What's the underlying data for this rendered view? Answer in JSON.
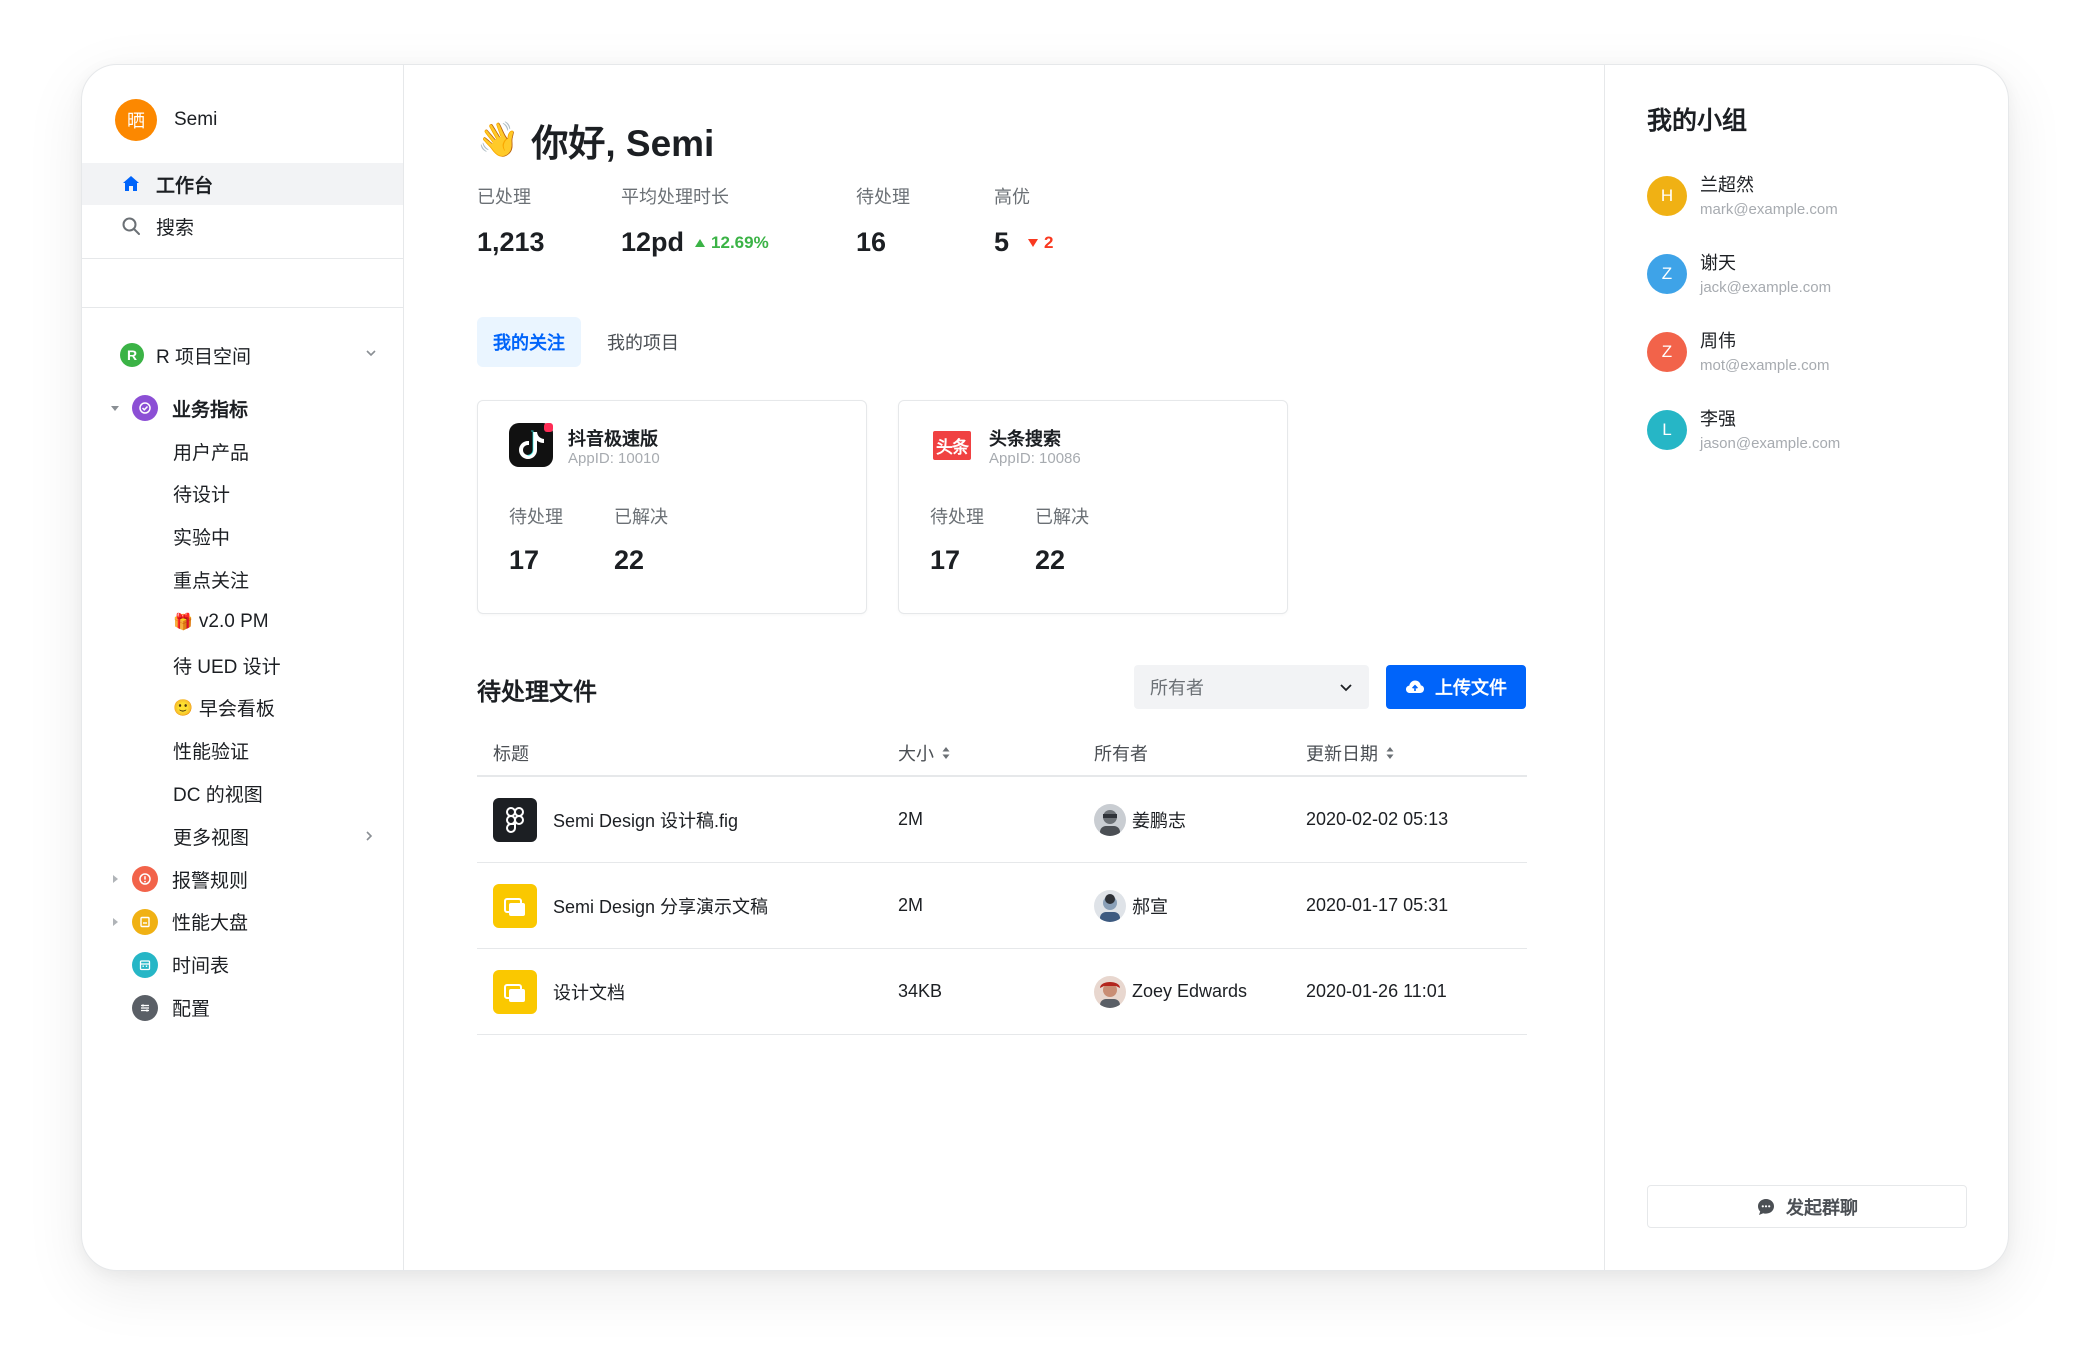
{
  "brand": {
    "logo_text": "晒",
    "name": "Semi"
  },
  "nav": [
    {
      "label": "工作台",
      "icon": "home-icon"
    },
    {
      "label": "搜索",
      "icon": "search-icon"
    }
  ],
  "space": {
    "badge": "R",
    "label": "R 项目空间"
  },
  "tree": {
    "group": "业务指标",
    "children": [
      "用户产品",
      "待设计",
      "实验中",
      "重点关注",
      "v2.0 PM",
      "待 UED 设计",
      "早会看板",
      "性能验证",
      "DC 的视图",
      "更多视图"
    ],
    "others": [
      "报警规则",
      "性能大盘",
      "时间表",
      "配置"
    ]
  },
  "greeting": {
    "emoji": "👋",
    "text": "你好, Semi"
  },
  "stats": [
    {
      "label": "已处理",
      "value": "1,213"
    },
    {
      "label": "平均处理时长",
      "value": "12pd",
      "trend": "12.69%"
    },
    {
      "label": "待处理",
      "value": "16"
    },
    {
      "label": "高优",
      "value": "5",
      "trend": "2"
    }
  ],
  "tabs": [
    "我的关注",
    "我的项目"
  ],
  "apps": [
    {
      "name": "抖音极速版",
      "appid": "AppID: 10010",
      "pending_label": "待处理",
      "pending": "17",
      "resolved_label": "已解决",
      "resolved": "22"
    },
    {
      "name": "头条搜索",
      "appid": "AppID: 10086",
      "logo_text": "头条",
      "pending_label": "待处理",
      "pending": "17",
      "resolved_label": "已解决",
      "resolved": "22"
    }
  ],
  "files": {
    "title": "待处理文件",
    "owner_select": "所有者",
    "upload_label": "上传文件",
    "columns": [
      "标题",
      "大小",
      "所有者",
      "更新日期"
    ],
    "rows": [
      {
        "title": "Semi Design 设计稿.fig",
        "size": "2M",
        "owner": "姜鹏志",
        "date": "2020-02-02 05:13"
      },
      {
        "title": "Semi Design 分享演示文稿",
        "size": "2M",
        "owner": "郝宣",
        "date": "2020-01-17 05:31"
      },
      {
        "title": "设计文档",
        "size": "34KB",
        "owner": "Zoey Edwards",
        "date": "2020-01-26 11:01"
      }
    ]
  },
  "group": {
    "title": "我的小组",
    "members": [
      {
        "initial": "H",
        "name": "兰超然",
        "email": "mark@example.com",
        "color": "#f0b114"
      },
      {
        "initial": "Z",
        "name": "谢天",
        "email": "jack@example.com",
        "color": "#3ea3e8"
      },
      {
        "initial": "Z",
        "name": "周伟",
        "email": "mot@example.com",
        "color": "#f2634a"
      },
      {
        "initial": "L",
        "name": "李强",
        "email": "jason@example.com",
        "color": "#26b6c6"
      }
    ],
    "chat_button": "发起群聊"
  },
  "colors": {
    "primary": "#0064fa",
    "up": "#3bb346",
    "down": "#f93920",
    "brand": "#fc8800"
  }
}
